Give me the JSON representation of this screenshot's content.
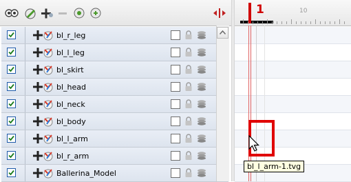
{
  "toolbar": {
    "buttons": [
      {
        "name": "onion-skin-icon"
      },
      {
        "name": "add-drawing-layer-icon"
      },
      {
        "name": "add-layer-icon"
      },
      {
        "name": "remove-layer-icon"
      },
      {
        "name": "add-peg-icon"
      },
      {
        "name": "add-parent-peg-icon"
      }
    ],
    "scale_icon": "scale-frames-icon"
  },
  "layers": [
    {
      "name": "bl_r_leg",
      "checked": true
    },
    {
      "name": "bl_l_leg",
      "checked": true
    },
    {
      "name": "bl_skirt",
      "checked": true
    },
    {
      "name": "bl_head",
      "checked": true
    },
    {
      "name": "bl_neck",
      "checked": true
    },
    {
      "name": "bl_body",
      "checked": true
    },
    {
      "name": "bl_l_arm",
      "checked": true
    },
    {
      "name": "bl_r_arm",
      "checked": true
    },
    {
      "name": "Ballerina_Model",
      "checked": true
    }
  ],
  "timeline": {
    "current_frame": "1",
    "frame_marker": "10",
    "tooltip": "bl_l_arm-1.tvg"
  },
  "colors": {
    "accent": "#e00000",
    "row_bg": "#e3e9f2",
    "checkbox_border": "#1e5aa8"
  }
}
